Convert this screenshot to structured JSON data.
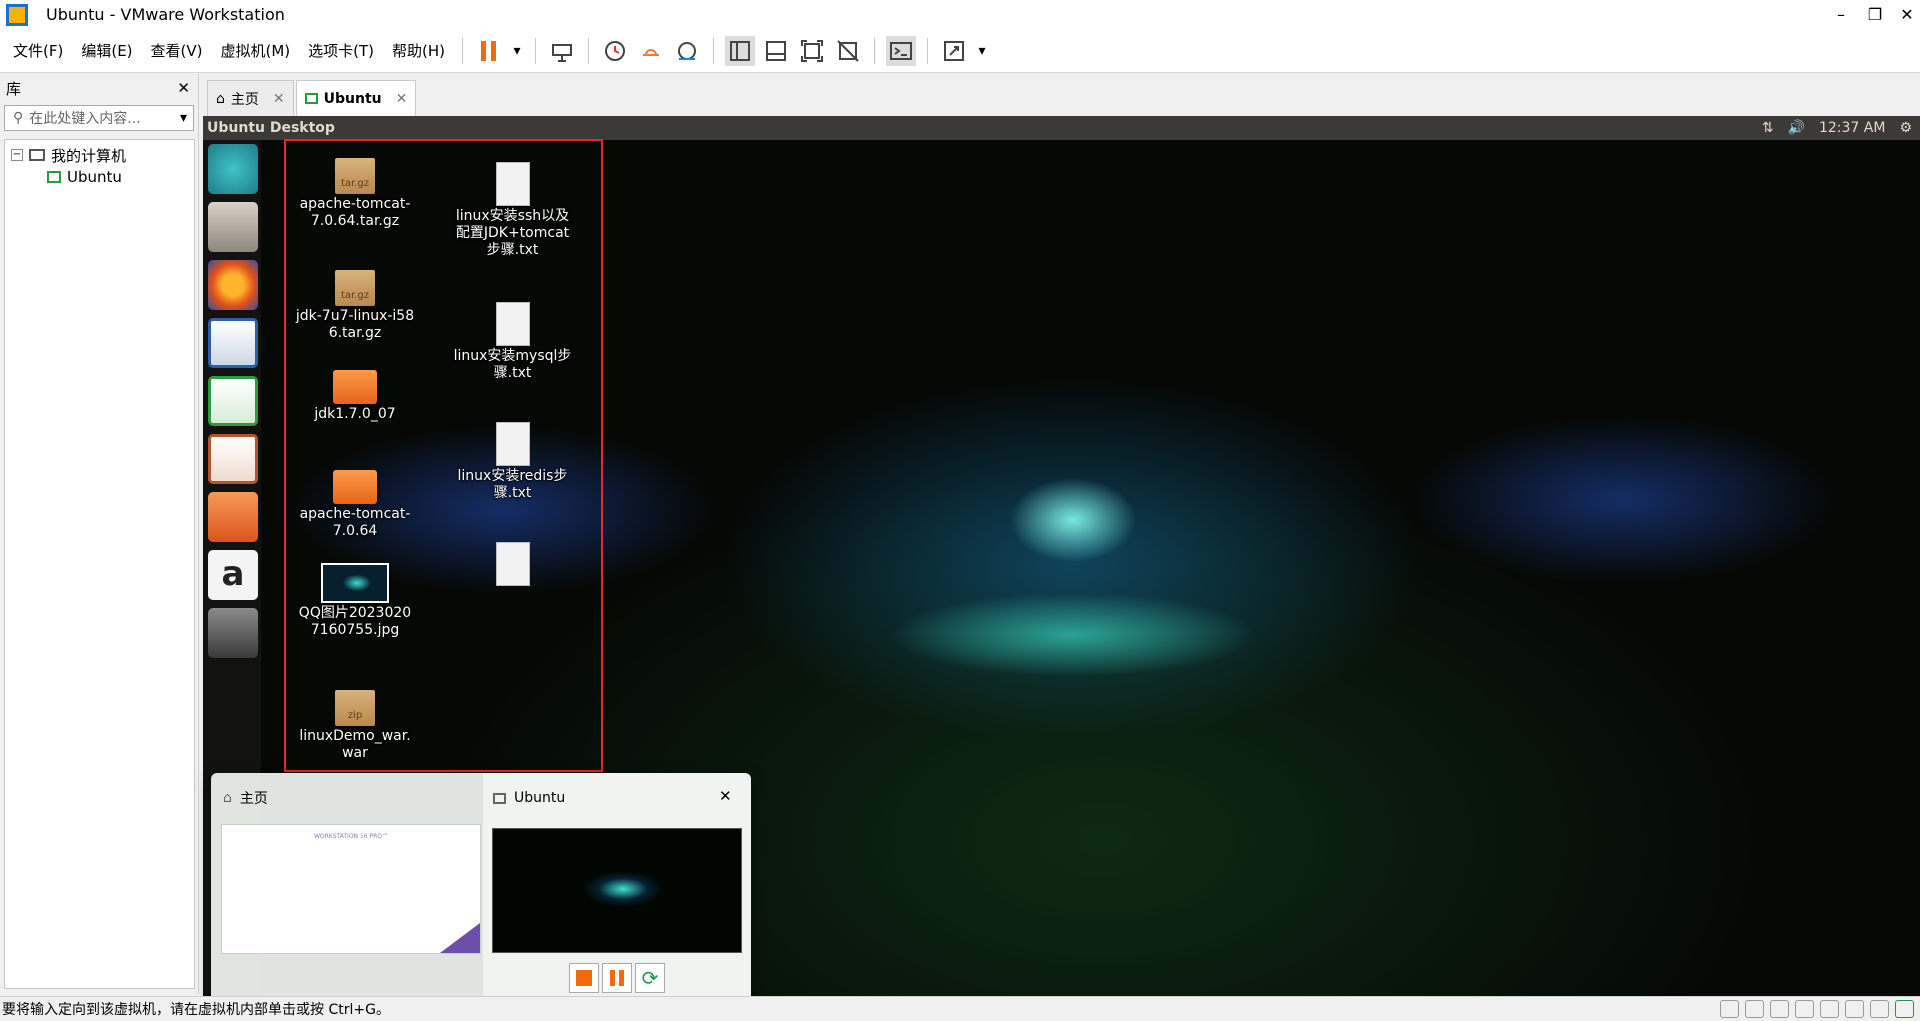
{
  "window": {
    "title": "Ubuntu - VMware Workstation"
  },
  "menu": [
    "文件(F)",
    "编辑(E)",
    "查看(V)",
    "虚拟机(M)",
    "选项卡(T)",
    "帮助(H)"
  ],
  "library": {
    "title": "库",
    "search_placeholder": "在此处键入内容...",
    "tree": {
      "root": "我的计算机",
      "child": "Ubuntu"
    }
  },
  "tabs": [
    {
      "label": "主页"
    },
    {
      "label": "Ubuntu"
    }
  ],
  "vm": {
    "desktop_title": "Ubuntu Desktop",
    "clock": "12:37 AM",
    "desktop_icons": [
      {
        "label": "apache-tomcat-7.0.64.tar.gz",
        "badge": "tar.gz"
      },
      {
        "label": "jdk-7u7-linux-i586.tar.gz",
        "badge": "tar.gz"
      },
      {
        "label": "jdk1.7.0_07"
      },
      {
        "label": "apache-tomcat-7.0.64"
      },
      {
        "label": "QQ图片20230207160755.jpg"
      },
      {
        "label": "linuxDemo_war.war",
        "badge": "zip"
      },
      {
        "label": "linux安装ssh以及配置JDK+tomcat步骤.txt"
      },
      {
        "label": "linux安装mysql步骤.txt"
      },
      {
        "label": "linux安装redis步骤.txt"
      }
    ]
  },
  "thumbnails": {
    "home": {
      "label": "主页",
      "caption": "WORKSTATION 16 PRO™"
    },
    "vm": {
      "label": "Ubuntu"
    }
  },
  "status": {
    "text": "要将输入定向到该虚拟机，请在虚拟机内部单击或按 Ctrl+G。"
  },
  "colors": {
    "selection_border": "#e62828",
    "pause": "#f26a10",
    "stop": "#f26a10",
    "restart": "#1a9a4a"
  }
}
